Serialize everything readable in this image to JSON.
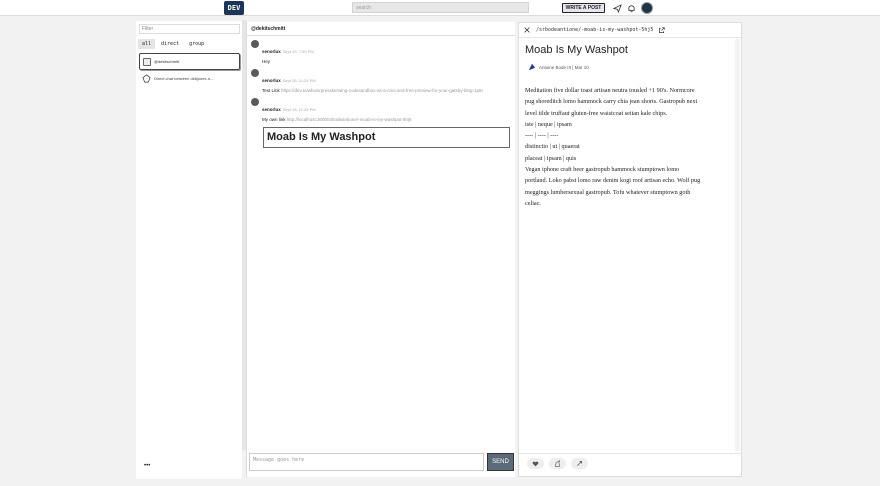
{
  "topbar": {
    "logo": "DEV",
    "search_placeholder": "search",
    "write_label": "WRITE A POST",
    "icons": [
      "paper-plane-icon",
      "bell-icon",
      "avatar"
    ]
  },
  "left": {
    "filter_placeholder": "Filter",
    "tabs": [
      "all",
      "direct",
      "group"
    ],
    "channels": [
      {
        "label": "@dekitschmitt"
      },
      {
        "label": "Direct chat between dk6jones a..."
      }
    ],
    "more": "•••"
  },
  "chat": {
    "header": "@dekitschmitt",
    "messages": [
      {
        "name": "senorlux",
        "time": "Sept 28, 7:50 PM",
        "text": "Hey",
        "link": ""
      },
      {
        "name": "senorlux",
        "time": "Sept 28, 11:24 PM",
        "text": "Test Link ",
        "link": "https://dev.to/whoisrpresskerwing-codesandbox-as-a-cms-and-free-preview-for-your-gatsby-blog-1p5I"
      },
      {
        "name": "senorlux",
        "time": "Sept 28, 11:24 PM",
        "text": "My own link ",
        "link": "http://localhost:3000/srbodeantione/-moab-is-my-washpot-5hj5"
      }
    ],
    "preview_title": "Moab Is My Washpot",
    "compose_placeholder": "Message goes here",
    "send_label": "SEND"
  },
  "article": {
    "path": "/srbodeantione/-moab-is-my-washpot-5hj5",
    "title": "Moab Is My Washpot",
    "byline": "Antoine Bode III | Mar 10",
    "body_lines": [
      "Meditation five dollar toast artisan neutra tousled +1 90's. Normcore",
      "pug shoreditch lomo hammock carry chia jean shorts. Gastropub next",
      "level tilde truffaut gluten-free waistcoat seitan kale chips.",
      "iste | neque | ipsam",
      "---- | ---- | ----",
      "distinctio | ut | quaerat",
      "placeat | ipsam | quis",
      "Vegan iphone craft beer gastropub hammock stumptown lomo",
      "portland. Loko pabst lomo raw denim kogi roof artisan echo. Wolf pug",
      "meggings lumbersexual gastropub. Tofu whatever stumptown goth",
      "celiac."
    ]
  }
}
